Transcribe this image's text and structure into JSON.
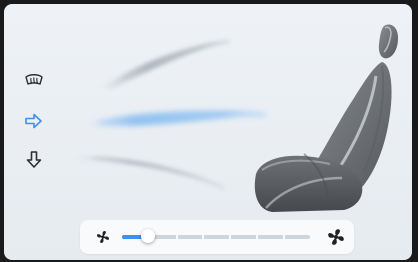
{
  "climate": {
    "airflow_modes": [
      {
        "icon": "windshield-defrost-icon",
        "active": false
      },
      {
        "icon": "face-vent-arrow-icon",
        "active": true
      },
      {
        "icon": "feet-vent-arrow-icon",
        "active": false
      }
    ],
    "fan": {
      "min_icon": "fan-low-icon",
      "max_icon": "fan-high-icon",
      "level_fraction": 0.14,
      "segments": 7
    },
    "colors": {
      "accent": "#3f8ff0",
      "inactive_icon": "#2e2e2e",
      "background": "#eef2f6",
      "seat": "#707478"
    }
  }
}
